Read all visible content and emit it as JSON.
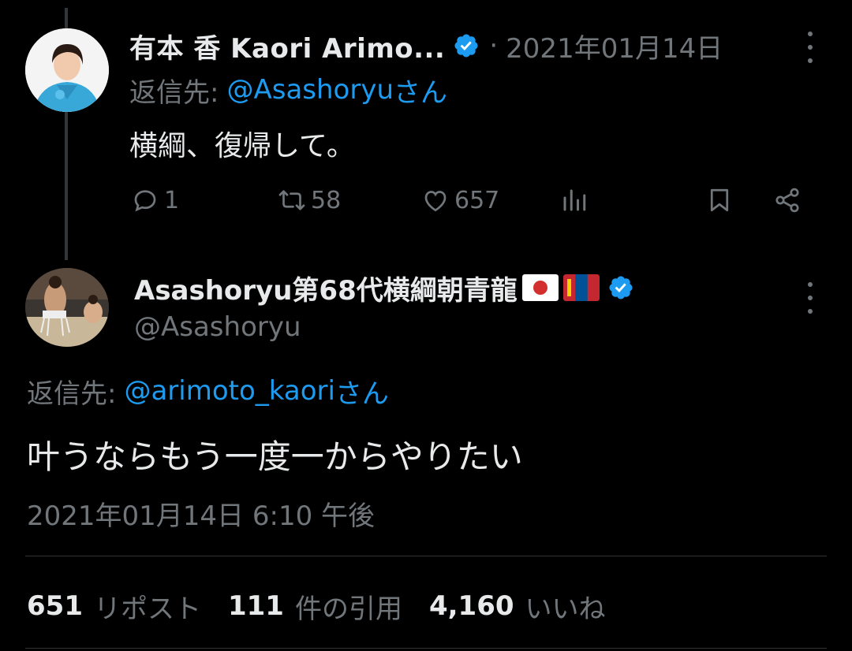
{
  "parent_tweet": {
    "author_name": "有本  香  Kaori Arimo...",
    "separator": "·",
    "date": "2021年01月14日",
    "reply_prefix": "返信先:",
    "reply_handle": "@Asashoryu",
    "reply_suffix": "さん",
    "text": "横綱、復帰して。",
    "replies": "1",
    "retweets": "58",
    "likes": "657"
  },
  "main_tweet": {
    "author_name": "Asashoryu第68代横綱朝青龍",
    "handle": "@Asashoryu",
    "reply_prefix": "返信先:",
    "reply_handle": "@arimoto_kaori",
    "reply_suffix": "さん",
    "text": "叶うならもう一度一からやりたい",
    "timestamp": "2021年01月14日 6:10 午後"
  },
  "stats": {
    "reposts_count": "651",
    "reposts_label": "リポスト",
    "quotes_count": "111",
    "quotes_label": "件の引用",
    "likes_count": "4,160",
    "likes_label": "いいね"
  },
  "colors": {
    "background": "#000000",
    "text": "#e7e9ea",
    "muted": "#71767b",
    "link": "#1d9bf0",
    "verified": "#1d9bf0"
  },
  "icons": [
    "verified-badge-icon",
    "reply-icon",
    "retweet-icon",
    "like-icon",
    "views-icon",
    "bookmark-icon",
    "share-icon",
    "more-icon",
    "japan-flag",
    "mongolia-flag"
  ]
}
